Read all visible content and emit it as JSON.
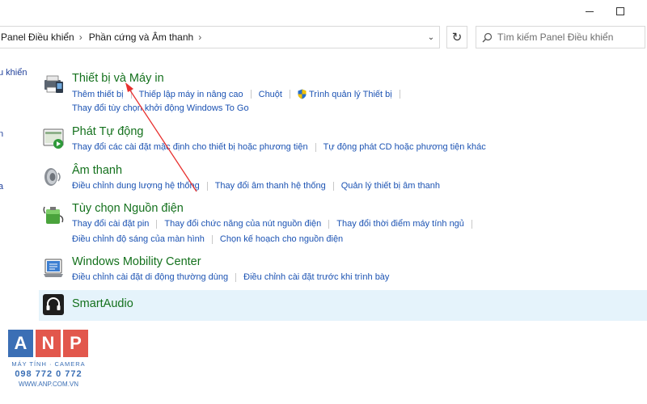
{
  "address_bar": {
    "crumbs": [
      "Panel Điều khiển",
      "Phần cứng và Âm thanh"
    ]
  },
  "search": {
    "placeholder": "Tìm kiếm Panel Điều khiển"
  },
  "sidebar": {
    "items": [
      "u khiển",
      "a"
    ]
  },
  "categories": [
    {
      "icon": "printer-icon",
      "title": "Thiết bị và Máy in",
      "links_row1": [
        "Thêm thiết bị",
        "Thiếp lập máy in nâng cao",
        "Chuột",
        "Trình quản lý Thiết bị"
      ],
      "links_row2": [
        "Thay đổi tùy chọn khởi động Windows To Go"
      ]
    },
    {
      "icon": "autoplay-icon",
      "title": "Phát Tự động",
      "links_row1": [
        "Thay đổi các cài đặt mặc định cho thiết bị hoặc phương tiện",
        "Tự động phát CD hoặc phương tiện khác"
      ]
    },
    {
      "icon": "speaker-icon",
      "title": "Âm thanh",
      "links_row1": [
        "Điều chỉnh dung lượng hệ thống",
        "Thay đổi âm thanh hệ thống",
        "Quản lý thiết bị âm thanh"
      ]
    },
    {
      "icon": "battery-icon",
      "title": "Tùy chọn Nguồn điện",
      "links_row1": [
        "Thay đổi cài đặt pin",
        "Thay đổi chức năng của nút nguồn điện",
        "Thay đổi thời điểm máy tính ngủ"
      ],
      "links_row2": [
        "Điều chỉnh độ sáng của màn hình",
        "Chọn kế hoạch cho nguồn điện"
      ]
    },
    {
      "icon": "mobility-center-icon",
      "title": "Windows Mobility Center",
      "links_row1": [
        "Điều chỉnh cài đặt di động thường dùng",
        "Điều chỉnh cài đặt trước khi trình bày"
      ]
    },
    {
      "icon": "smartaudio-icon",
      "title": "SmartAudio"
    }
  ],
  "watermark": {
    "letters": [
      "A",
      "N",
      "P"
    ],
    "colors": [
      "#3b6fb5",
      "#e2574c",
      "#e2574c"
    ],
    "tagline": "MÁY TÍNH · CAMERA",
    "phone": "098 772 0 772",
    "website": "WWW.ANP.COM.VN"
  },
  "annotation_color": "#e8312f"
}
